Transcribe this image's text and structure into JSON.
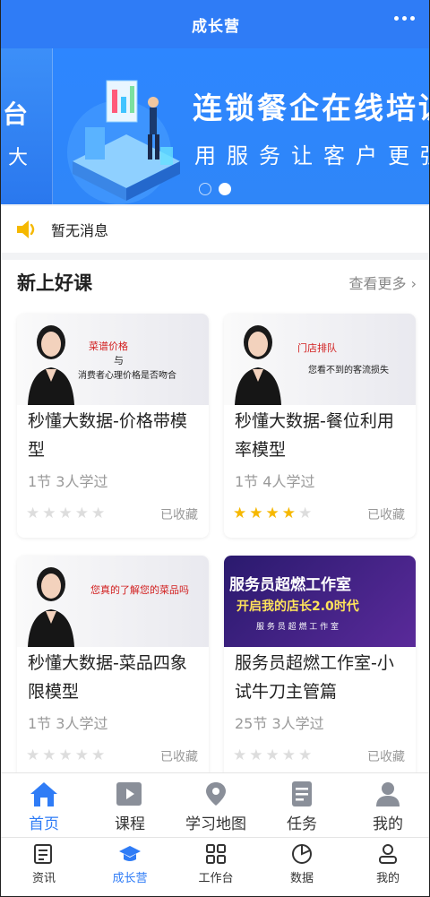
{
  "header": {
    "title": "成长营"
  },
  "banner": {
    "edge_text_top": "台",
    "edge_text_bottom": "大",
    "headline": "连锁餐企在线培训平",
    "subline": "用服务让客户更强"
  },
  "notice": {
    "text": "暂无消息"
  },
  "section": {
    "title": "新上好课",
    "more": "查看更多"
  },
  "courses": [
    {
      "thumb_lines": [
        "菜谱价格",
        "与",
        "消费者心理价格是否吻合"
      ],
      "name": "秒懂大数据-价格带模型",
      "meta": "1节 3人学过",
      "rating": 0,
      "fav": "已收藏"
    },
    {
      "thumb_lines": [
        "门店排队",
        "您看不到的客流损失"
      ],
      "name": "秒懂大数据-餐位利用率模型",
      "meta": "1节 4人学过",
      "rating": 4,
      "fav": "已收藏"
    },
    {
      "thumb_lines": [
        "您真的了解您的菜品吗"
      ],
      "name": "秒懂大数据-菜品四象限模型",
      "meta": "1节 3人学过",
      "rating": 0,
      "fav": "已收藏"
    },
    {
      "thumb_lines": [
        "服务员超燃工作室",
        "开启我的店长2.0时代",
        "服 务 员 超 燃 工 作 室"
      ],
      "name": "服务员超燃工作室-小试牛刀主管篇",
      "meta": "25节 3人学过",
      "rating": 0,
      "fav": "已收藏"
    }
  ],
  "tabbar_primary": [
    {
      "label": "首页",
      "icon": "home-icon",
      "active": true
    },
    {
      "label": "课程",
      "icon": "play-icon",
      "active": false
    },
    {
      "label": "学习地图",
      "icon": "map-pin-icon",
      "active": false
    },
    {
      "label": "任务",
      "icon": "document-icon",
      "active": false
    },
    {
      "label": "我的",
      "icon": "user-icon",
      "active": false
    }
  ],
  "tabbar_secondary": [
    {
      "label": "资讯",
      "icon": "news-icon",
      "active": false
    },
    {
      "label": "成长营",
      "icon": "graduation-cap-icon",
      "active": true
    },
    {
      "label": "工作台",
      "icon": "grid-icon",
      "active": false
    },
    {
      "label": "数据",
      "icon": "pie-chart-icon",
      "active": false
    },
    {
      "label": "我的",
      "icon": "user-outline-icon",
      "active": false
    }
  ],
  "colors": {
    "accent": "#2f7cf6",
    "star": "#f6b800",
    "speaker": "#f5b800"
  }
}
